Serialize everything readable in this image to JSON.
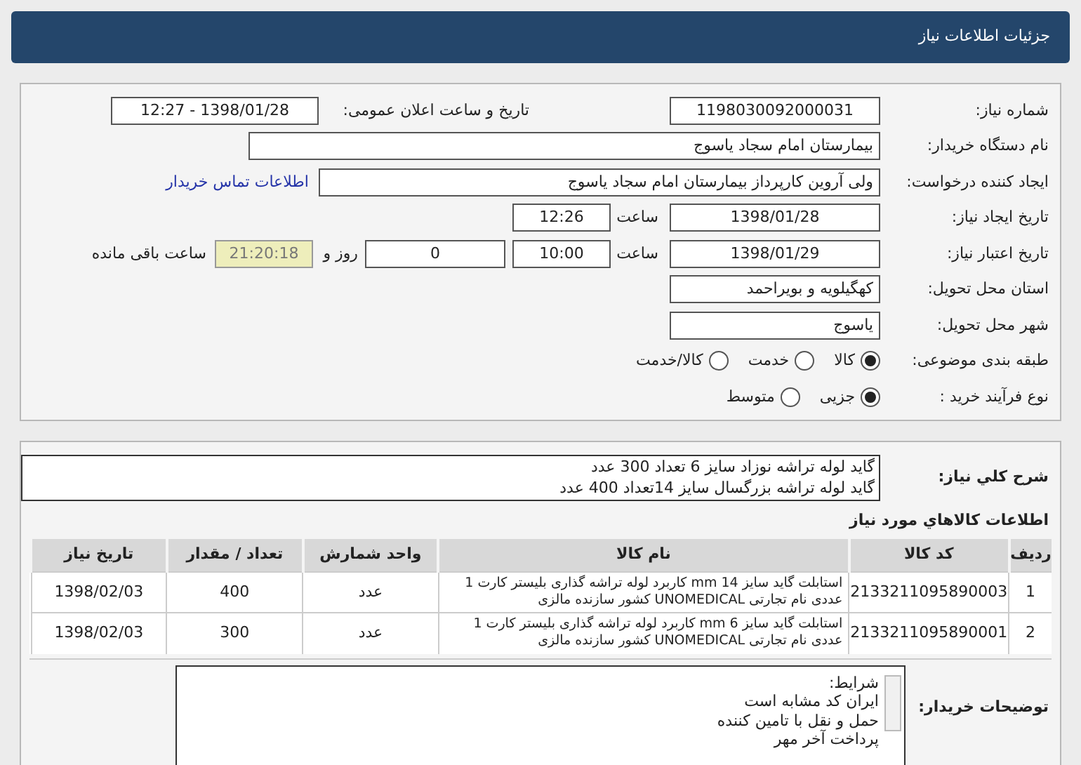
{
  "header": {
    "title": "جزئیات اطلاعات نیاز"
  },
  "details": {
    "need_number": {
      "label": "شماره نیاز:",
      "value": "1198030092000031"
    },
    "announce": {
      "label": "تاریخ و ساعت اعلان عمومی:",
      "value": "1398/01/28 - 12:27"
    },
    "buyer": {
      "label": "نام دستگاه خریدار:",
      "value": "بیمارستان امام سجاد یاسوج"
    },
    "creator": {
      "label": "ایجاد کننده درخواست:",
      "value": "ولی آروین کارپرداز بیمارستان امام سجاد یاسوج",
      "link": "اطلاعات تماس خریدار"
    },
    "created": {
      "label": "تاریخ ایجاد نیاز:",
      "date": "1398/01/28",
      "time_label": "ساعت",
      "time": "12:26"
    },
    "validity": {
      "label": "تاریخ اعتبار نیاز:",
      "date": "1398/01/29",
      "time_label": "ساعت",
      "time": "10:00",
      "days": "0",
      "days_label": "روز و",
      "remaining": "21:20:18",
      "remaining_label": "ساعت باقی مانده"
    },
    "province": {
      "label": "استان محل تحویل:",
      "value": "کهگیلویه و بویراحمد"
    },
    "city": {
      "label": "شهر محل تحویل:",
      "value": "یاسوج"
    },
    "category": {
      "label": "طبقه بندی موضوعی:",
      "options": [
        {
          "label": "کالا",
          "selected": true
        },
        {
          "label": "خدمت",
          "selected": false
        },
        {
          "label": "کالا/خدمت",
          "selected": false
        }
      ]
    },
    "process": {
      "label": "نوع فرآیند خرید :",
      "options": [
        {
          "label": "جزیی",
          "selected": true
        },
        {
          "label": "متوسط",
          "selected": false
        }
      ]
    }
  },
  "summary": {
    "label": "شرح کلي نياز:",
    "lines": [
      "گاید لوله تراشه نوزاد سایز 6 تعداد 300 عدد",
      "گاید لوله تراشه بزرگسال سایز 14تعداد 400 عدد"
    ]
  },
  "goods": {
    "title": "اطلاعات کالاهاي مورد نياز",
    "columns": [
      "ردیف",
      "کد کالا",
      "نام کالا",
      "واحد شمارش",
      "تعداد / مقدار",
      "تاریخ نیاز"
    ],
    "rows": [
      [
        "1",
        "2133211095890003",
        "استابلت گاید سایز mm 14 کاربرد لوله تراشه گذاری بلیستر کارت 1 عددی نام تجارتی UNOMEDICAL کشور سازنده مالزی",
        "عدد",
        "400",
        "1398/02/03"
      ],
      [
        "2",
        "2133211095890001",
        "استابلت گاید سایز mm 6 کاربرد لوله تراشه گذاری بلیستر کارت 1 عددی نام تجارتی UNOMEDICAL کشور سازنده مالزی",
        "عدد",
        "300",
        "1398/02/03"
      ]
    ]
  },
  "notes": {
    "label": "توضیحات خریدار:",
    "lines": [
      "شرایط:",
      "ایران کد مشابه است",
      "حمل و نقل با تامین کننده",
      "پرداخت آخر مهر"
    ]
  }
}
